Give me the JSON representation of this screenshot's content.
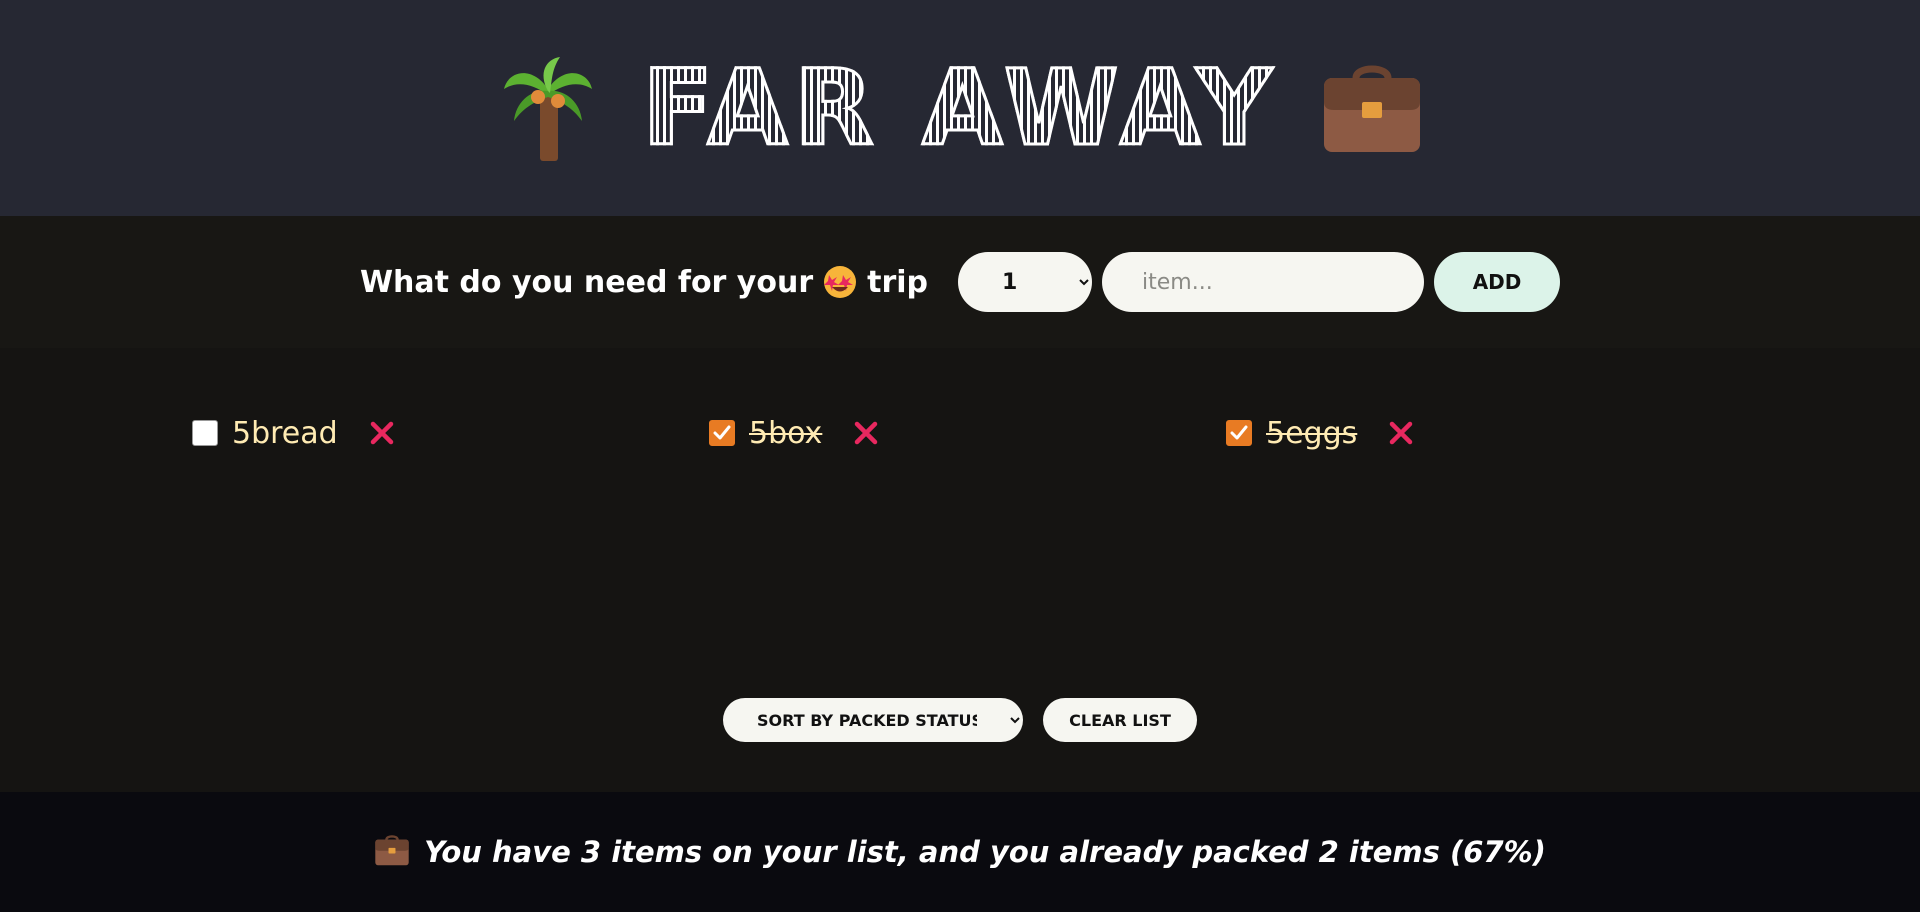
{
  "header": {
    "logo_text": "FAR AWAY",
    "left_icon": "palm-tree-icon",
    "right_icon": "briefcase-icon"
  },
  "form": {
    "title_before": "What do you need for your",
    "title_emoji": "star-struck-face-icon",
    "title_after": "trip",
    "quantity_value": "1",
    "quantity_options": [
      "1"
    ],
    "item_placeholder": "item...",
    "item_value": "",
    "add_label": "ADD"
  },
  "items": [
    {
      "label": "5bread",
      "packed": false
    },
    {
      "label": "5box",
      "packed": true
    },
    {
      "label": "5eggs",
      "packed": true
    }
  ],
  "actions": {
    "sort_value": "SORT BY PACKED STATUS",
    "sort_options": [
      "SORT BY PACKED STATUS"
    ],
    "clear_label": "CLEAR LIST"
  },
  "stats": {
    "icon": "briefcase-icon",
    "text": "You have 3 items on your list, and you already packed 2 items (67%)"
  },
  "colors": {
    "header_bg": "#262833",
    "form_bg": "#181714",
    "list_bg": "#151412",
    "footer_bg": "#0a0a0f",
    "item_text": "#ffebb3",
    "check_accent": "#e87b23",
    "delete": "#e8285f",
    "add_button": "#dcf3e9"
  }
}
